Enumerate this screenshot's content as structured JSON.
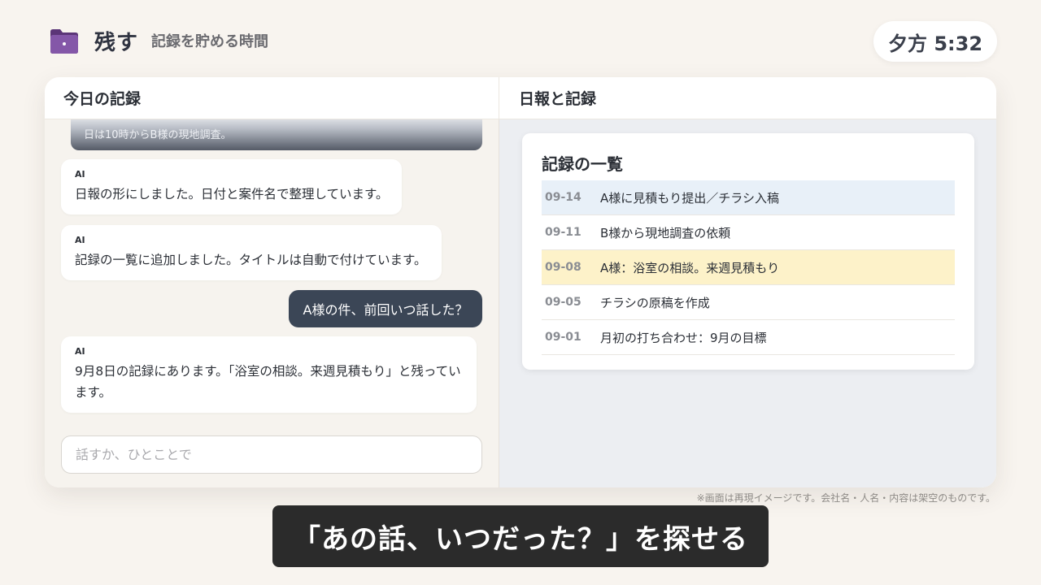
{
  "app": {
    "title": "残す",
    "subtitle": "記録を貯める時間",
    "clock": "夕方 5:32",
    "accent_color": "#7a4a9c"
  },
  "chat_pane": {
    "title": "今日の記録",
    "cut_message": "日は10時からB様の現地調査。",
    "messages": [
      {
        "sender": "AI",
        "text": "日報の形にしました。日付と案件名で整理しています。"
      },
      {
        "sender": "AI",
        "text": "記録の一覧に追加しました。タイトルは自動で付けています。"
      },
      {
        "sender": "user",
        "text": "A様の件、前回いつ話した？"
      },
      {
        "sender": "AI",
        "text": "9月8日の記録にあります。「浴室の相談。来週見積もり」と残っています。"
      }
    ],
    "input_placeholder": "話すか、ひとことで",
    "user_bubble_color": "#3b4656"
  },
  "records_pane": {
    "title": "日報と記録",
    "card_title": "記録の一覧",
    "records": [
      {
        "date": "09-14",
        "title": "A様に見積もり提出／チラシ入稿",
        "highlight": "blue"
      },
      {
        "date": "09-11",
        "title": "B様から現地調査の依頼",
        "highlight": "none"
      },
      {
        "date": "09-08",
        "title": "A様：浴室の相談。来週見積もり",
        "highlight": "yellow"
      },
      {
        "date": "09-05",
        "title": "チラシの原稿を作成",
        "highlight": "none"
      },
      {
        "date": "09-01",
        "title": "月初の打ち合わせ：9月の目標",
        "highlight": "none"
      }
    ]
  },
  "footer": {
    "disclaimer": "※画面は再現イメージです。会社名・人名・内容は架空のものです。",
    "caption": "「あの話、いつだった？」を探せる"
  },
  "icons": {
    "app_icon": "folder-icon"
  }
}
